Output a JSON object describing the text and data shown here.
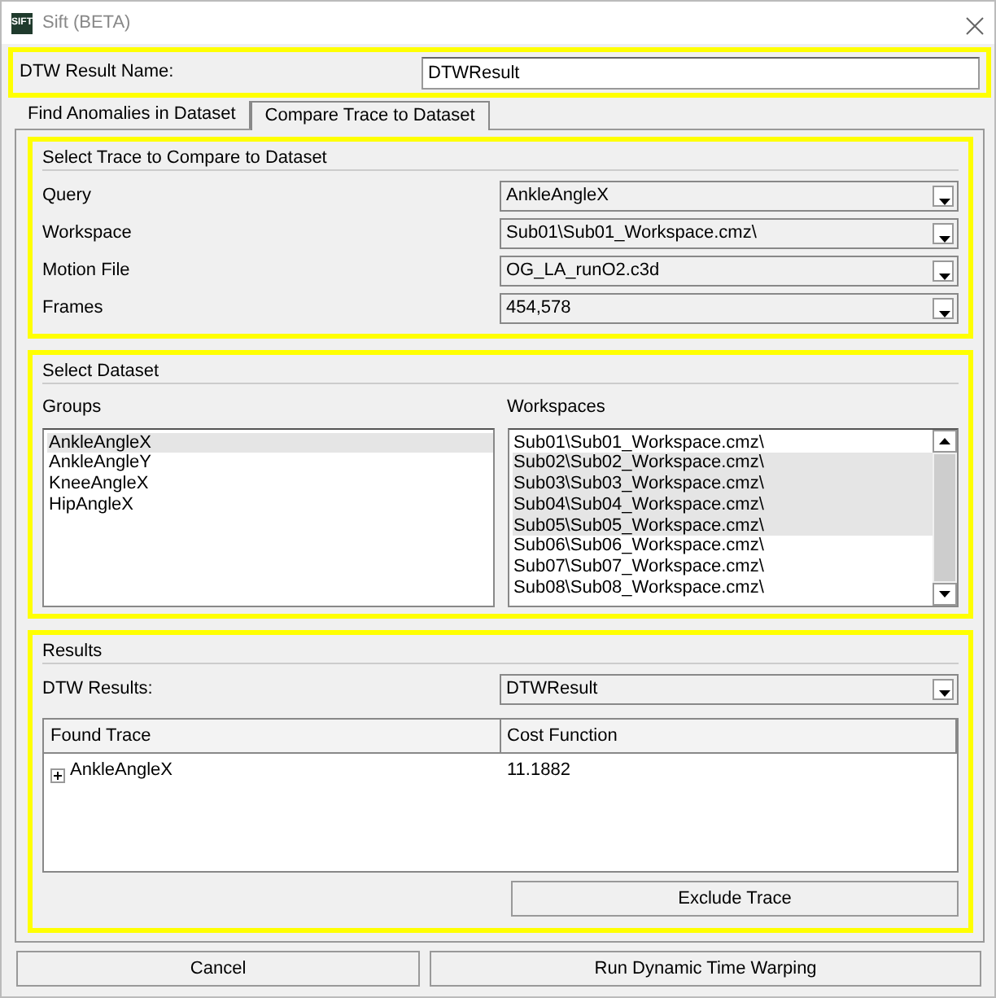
{
  "window": {
    "title": "Sift (BETA)",
    "logo": "SIFT"
  },
  "result_name": {
    "label": "DTW Result Name:",
    "value": "DTWResult"
  },
  "tabs": [
    {
      "label": "Find Anomalies in Dataset",
      "selected": false
    },
    {
      "label": "Compare Trace to Dataset",
      "selected": true
    }
  ],
  "trace_group": {
    "title": "Select Trace to Compare to Dataset",
    "fields": [
      {
        "label": "Query",
        "value": "AnkleAngleX"
      },
      {
        "label": "Workspace",
        "value": "Sub01\\Sub01_Workspace.cmz\\"
      },
      {
        "label": "Motion File",
        "value": "OG_LA_runO2.c3d"
      },
      {
        "label": "Frames",
        "value": "454,578"
      }
    ]
  },
  "dataset_group": {
    "title": "Select Dataset",
    "groups_label": "Groups",
    "groups": [
      {
        "label": "AnkleAngleX",
        "selected": true
      },
      {
        "label": "AnkleAngleY",
        "selected": false
      },
      {
        "label": "KneeAngleX",
        "selected": false
      },
      {
        "label": "HipAngleX",
        "selected": false
      }
    ],
    "workspaces_label": "Workspaces",
    "workspaces": [
      {
        "label": "Sub01\\Sub01_Workspace.cmz\\",
        "selected": false
      },
      {
        "label": "Sub02\\Sub02_Workspace.cmz\\",
        "selected": true
      },
      {
        "label": "Sub03\\Sub03_Workspace.cmz\\",
        "selected": true
      },
      {
        "label": "Sub04\\Sub04_Workspace.cmz\\",
        "selected": true
      },
      {
        "label": "Sub05\\Sub05_Workspace.cmz\\",
        "selected": true
      },
      {
        "label": "Sub06\\Sub06_Workspace.cmz\\",
        "selected": false
      },
      {
        "label": "Sub07\\Sub07_Workspace.cmz\\",
        "selected": false
      },
      {
        "label": "Sub08\\Sub08_Workspace.cmz\\",
        "selected": false
      }
    ]
  },
  "results_group": {
    "title": "Results",
    "label": "DTW Results:",
    "value": "DTWResult",
    "columns": [
      "Found Trace",
      "Cost Function"
    ],
    "rows": [
      {
        "cells": [
          "AnkleAngleX",
          "11.1882"
        ],
        "expanded": false
      }
    ],
    "button": "Exclude Trace"
  },
  "buttons": [
    "Cancel",
    "Run Dynamic Time Warping"
  ]
}
